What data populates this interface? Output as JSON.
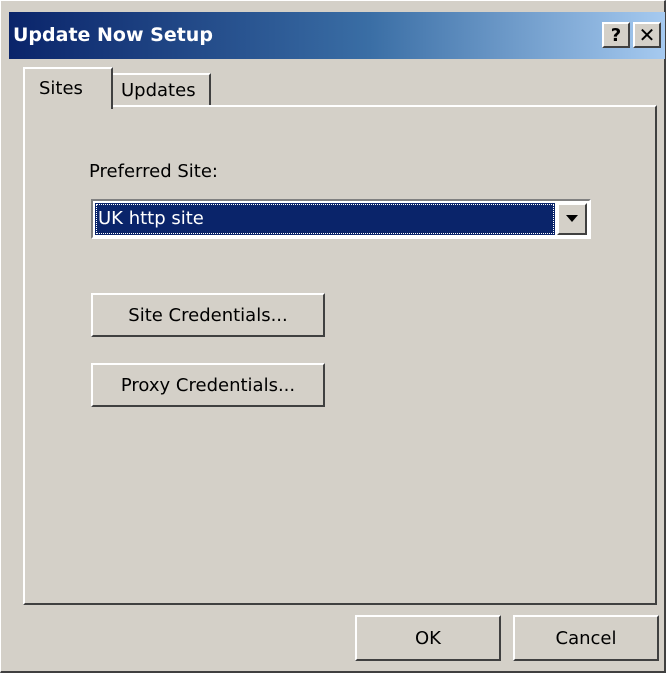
{
  "window": {
    "title": "Update Now Setup",
    "help_label": "?",
    "close_label": "✕"
  },
  "tabs": [
    {
      "label": "Sites",
      "selected": true
    },
    {
      "label": "Updates",
      "selected": false
    }
  ],
  "sites_tab": {
    "preferred_site_label": "Preferred Site:",
    "preferred_site_value": "UK http site",
    "site_credentials_label": "Site Credentials...",
    "proxy_credentials_label": "Proxy Credentials..."
  },
  "footer": {
    "ok_label": "OK",
    "cancel_label": "Cancel"
  },
  "colors": {
    "title_bar": "#0a246a",
    "dialog_face": "#d4d0c8",
    "selection": "#0a246a"
  }
}
